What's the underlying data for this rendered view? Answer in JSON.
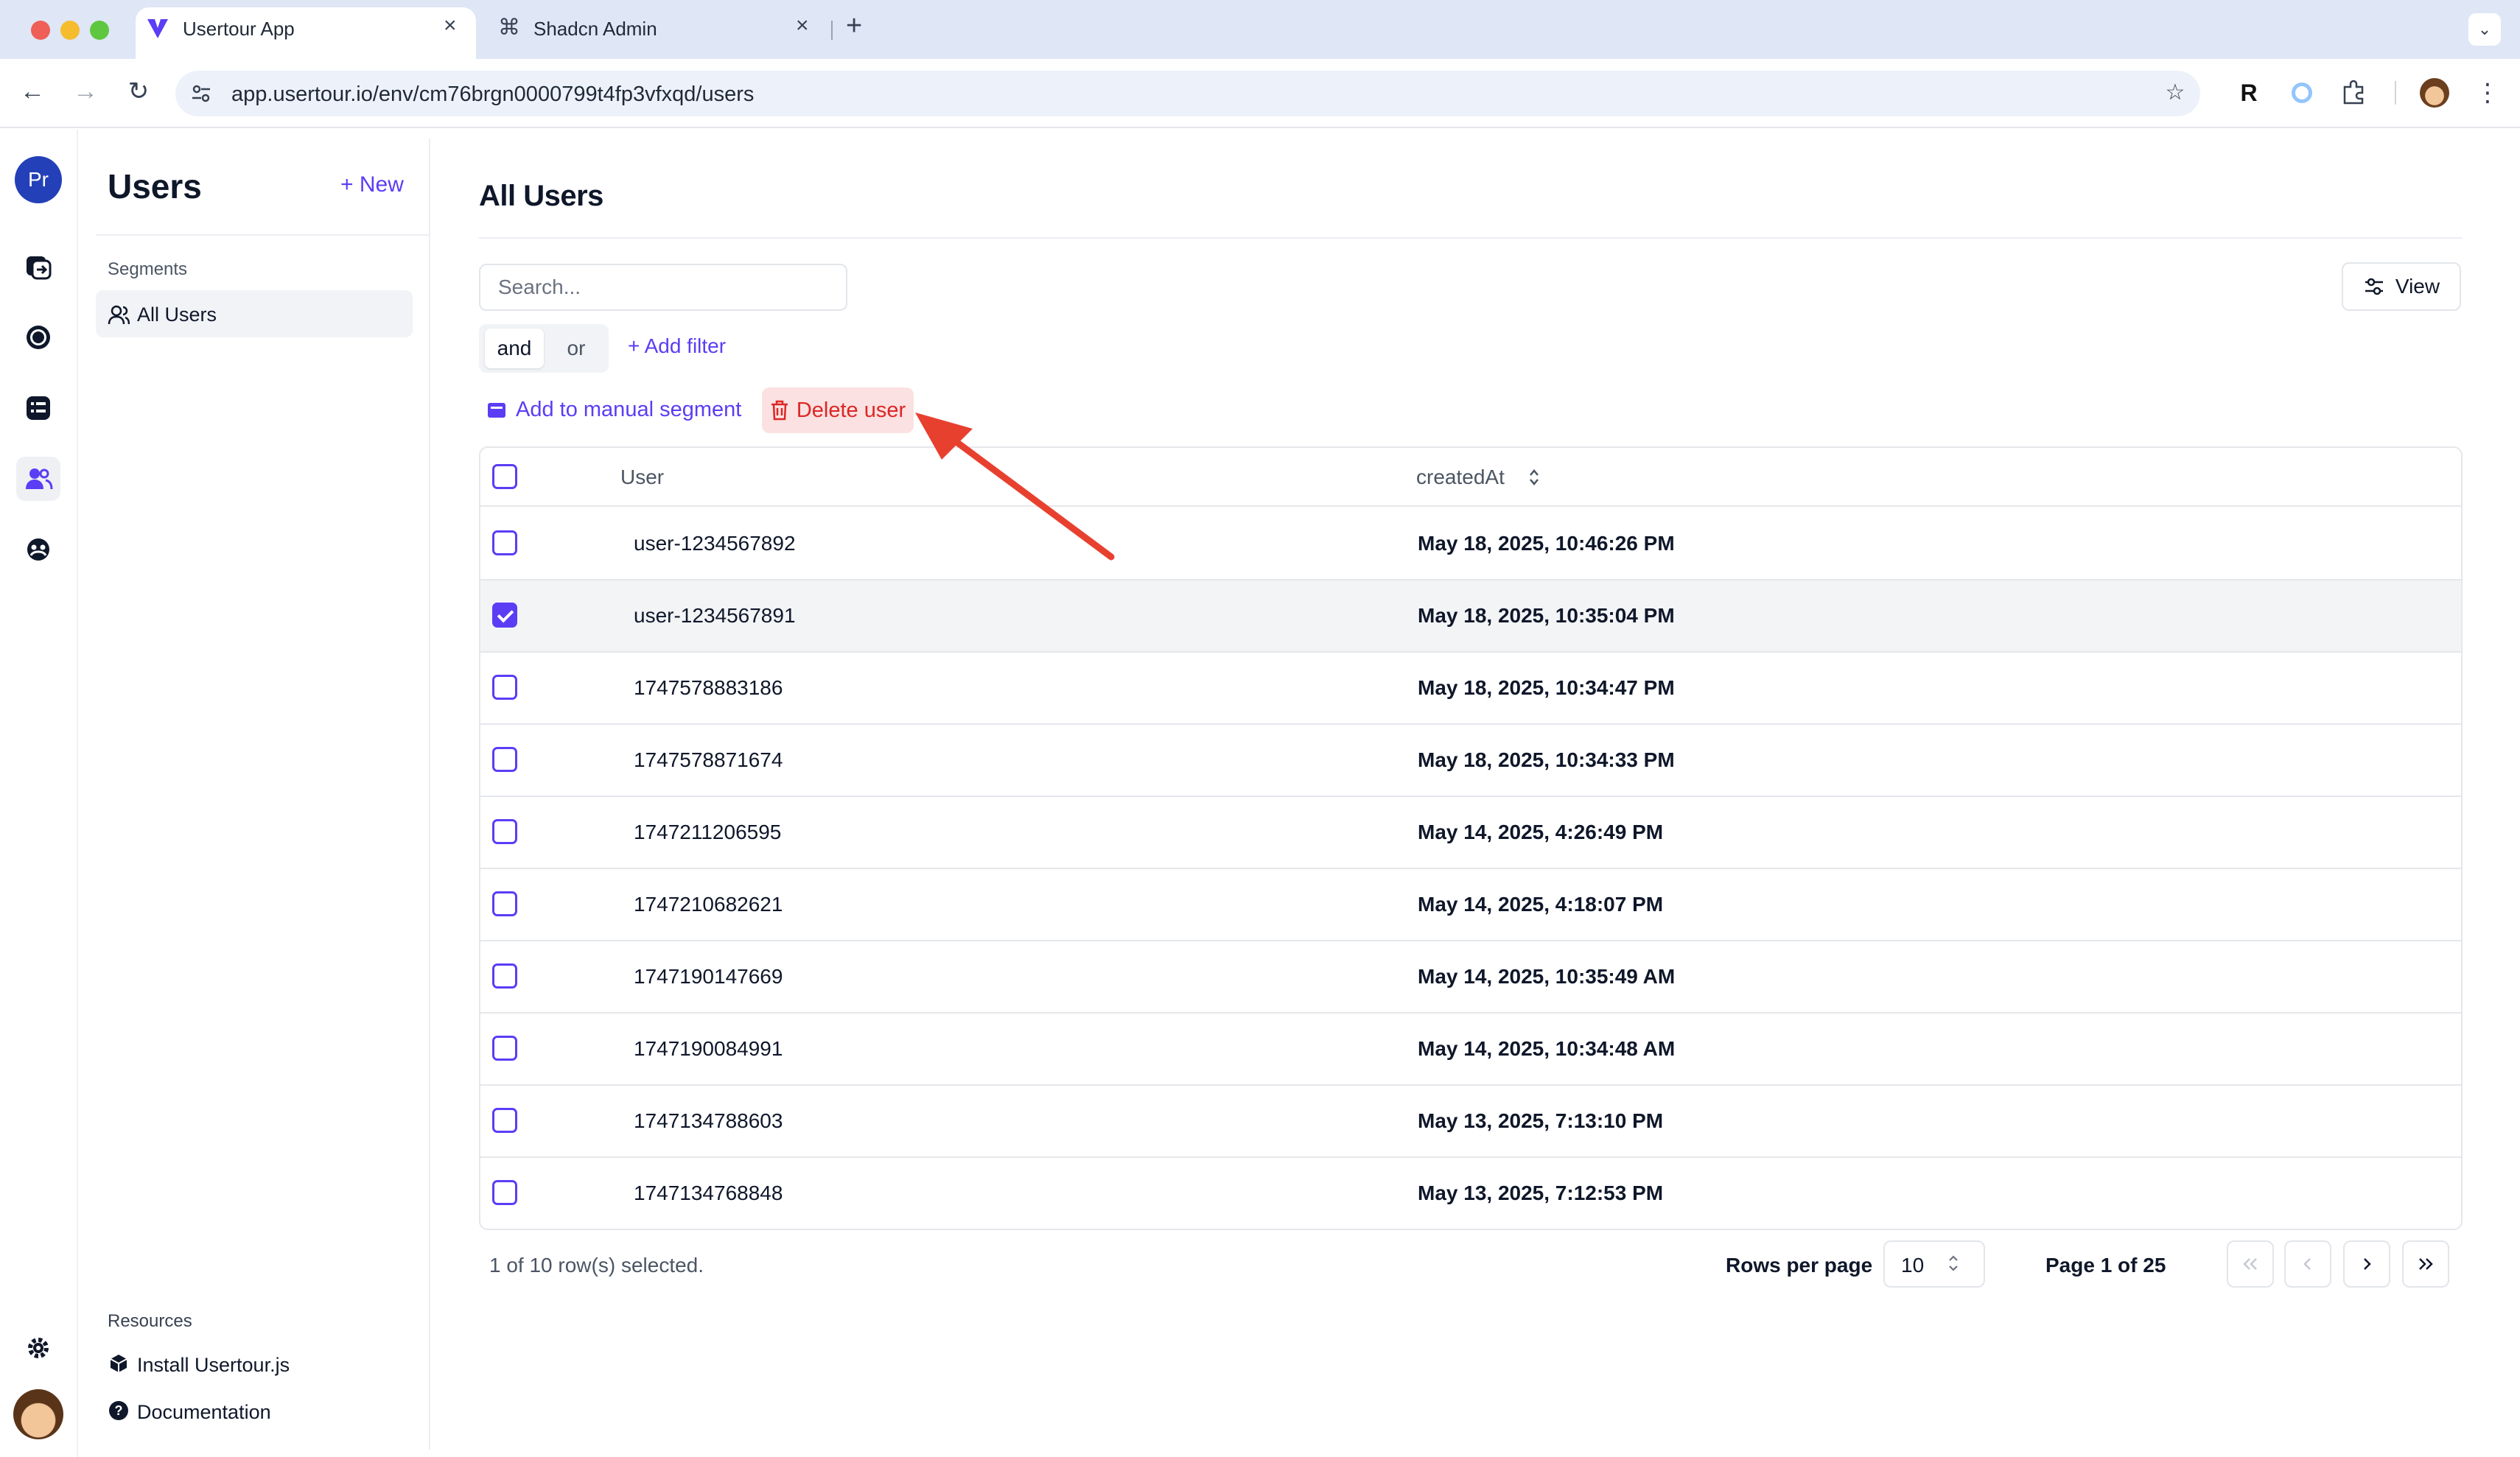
{
  "browser": {
    "tabs": [
      {
        "title": "Usertour App",
        "active": true
      },
      {
        "title": "Shadcn Admin",
        "active": false
      }
    ],
    "url": "app.usertour.io/env/cm76brgn0000799t4fp3vfxqd/users",
    "new_tab_symbol": "+",
    "profile_ext_letter": "R"
  },
  "rail": {
    "project_initials": "Pr"
  },
  "sidebar": {
    "title": "Users",
    "new_label": "+ New",
    "segments_label": "Segments",
    "segments": [
      {
        "label": "All Users",
        "selected": true
      }
    ],
    "resources_label": "Resources",
    "resources": [
      {
        "label": "Install Usertour.js"
      },
      {
        "label": "Documentation"
      }
    ]
  },
  "main": {
    "title": "All Users",
    "search_placeholder": "Search...",
    "view_label": "View",
    "logic": {
      "and": "and",
      "or": "or",
      "active": "and"
    },
    "add_filter_label": "+ Add filter",
    "bulk_actions": {
      "add_to_segment": "Add to manual segment",
      "delete_user": "Delete user"
    },
    "table": {
      "columns": [
        "User",
        "createdAt"
      ],
      "rows": [
        {
          "user": "user-1234567892",
          "createdAt": "May 18, 2025, 10:46:26 PM",
          "selected": false
        },
        {
          "user": "user-1234567891",
          "createdAt": "May 18, 2025, 10:35:04 PM",
          "selected": true
        },
        {
          "user": "1747578883186",
          "createdAt": "May 18, 2025, 10:34:47 PM",
          "selected": false
        },
        {
          "user": "1747578871674",
          "createdAt": "May 18, 2025, 10:34:33 PM",
          "selected": false
        },
        {
          "user": "1747211206595",
          "createdAt": "May 14, 2025, 4:26:49 PM",
          "selected": false
        },
        {
          "user": "1747210682621",
          "createdAt": "May 14, 2025, 4:18:07 PM",
          "selected": false
        },
        {
          "user": "1747190147669",
          "createdAt": "May 14, 2025, 10:35:49 AM",
          "selected": false
        },
        {
          "user": "1747190084991",
          "createdAt": "May 14, 2025, 10:34:48 AM",
          "selected": false
        },
        {
          "user": "1747134788603",
          "createdAt": "May 13, 2025, 7:13:10 PM",
          "selected": false
        },
        {
          "user": "1747134768848",
          "createdAt": "May 13, 2025, 7:12:53 PM",
          "selected": false
        }
      ]
    },
    "footer": {
      "selection_text": "1 of 10 row(s) selected.",
      "rows_per_page_label": "Rows per page",
      "rows_per_page_value": "10",
      "page_text": "Page 1 of 25"
    }
  },
  "colors": {
    "accent": "#5b3df5",
    "danger": "#dc2626",
    "danger_bg": "#fbe1e1",
    "annotation_arrow": "#e8402f"
  }
}
